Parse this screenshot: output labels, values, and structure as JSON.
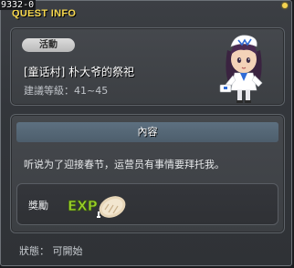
{
  "window": {
    "quest_id": "9332-0",
    "title": "QUEST INFO"
  },
  "quest": {
    "category_badge": "活動",
    "name": "[童话村] 朴大爷的祭祀",
    "level_range": "建議等級：41~45"
  },
  "content": {
    "header": "內容",
    "description": "听说为了迎接春节，运营员有事情要拜托我。"
  },
  "reward": {
    "label": "獎勵",
    "items": [
      "exp-icon",
      "bread-icon"
    ]
  },
  "status": {
    "text": "狀態： 可開始"
  },
  "colors": {
    "title": "#f7d84e",
    "header_bar": "#5d7080",
    "panel": "#45484d"
  }
}
